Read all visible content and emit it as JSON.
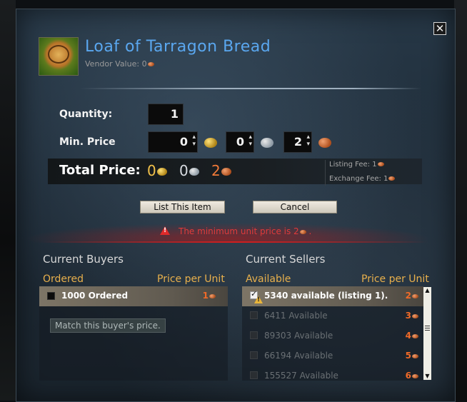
{
  "item": {
    "name": "Loaf of Tarragon Bread",
    "vendor_label": "Vendor Value:",
    "vendor_value": "0"
  },
  "close_label": "✕",
  "form": {
    "quantity_label": "Quantity:",
    "quantity_value": "1",
    "min_price_label": "Min. Price",
    "gold": "0",
    "silver": "0",
    "copper": "2",
    "total_label": "Total Price:",
    "total_gold": "0",
    "total_silver": "0",
    "total_copper": "2"
  },
  "fees": {
    "listing_label": "Listing Fee:",
    "listing_value": "1",
    "exchange_label": "Exchange Fee:",
    "exchange_value": "1"
  },
  "buttons": {
    "list": "List This Item",
    "cancel": "Cancel"
  },
  "error": {
    "text": "The minimum unit price is 2",
    "suffix": "."
  },
  "buyers": {
    "title": "Current Buyers",
    "col_left": "Ordered",
    "col_right": "Price per Unit",
    "rows": [
      {
        "label": "1000 Ordered",
        "price": "1"
      }
    ],
    "tooltip": "Match this buyer's price."
  },
  "sellers": {
    "title": "Current Sellers",
    "col_left": "Available",
    "col_right": "Price per Unit",
    "rows": [
      {
        "label": "5340 available (listing 1).",
        "price": "2"
      },
      {
        "label": "6411 Available",
        "price": "3"
      },
      {
        "label": "89303 Available",
        "price": "4"
      },
      {
        "label": "66194 Available",
        "price": "5"
      },
      {
        "label": "155527 Available",
        "price": "6"
      }
    ]
  },
  "colors": {
    "title_blue": "#5aa7ef",
    "header_orange": "#e8b04c",
    "price_orange": "#f06a28",
    "error_red": "#e23a3a"
  }
}
